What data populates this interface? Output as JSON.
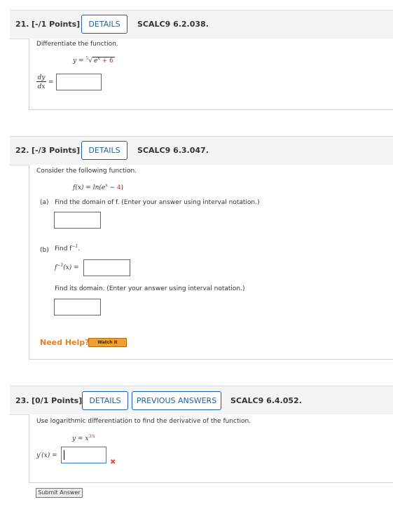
{
  "q21": {
    "number": "21.",
    "points": "[-/1 Points]",
    "details": "DETAILS",
    "code": "SCALC9 6.2.038.",
    "prompt": "Differentiate the function.",
    "func_lhs": "y =",
    "root_index": "5",
    "radicand_base": "e",
    "radicand_exp": "x",
    "radicand_tail": "+ 6",
    "dy": "dy",
    "dx": "dx",
    "eq": "="
  },
  "q22": {
    "number": "22.",
    "points": "[-/3 Points]",
    "details": "DETAILS",
    "code": "SCALC9 6.3.047.",
    "prompt": "Consider the following function.",
    "func": "f(x) = ln(e",
    "func_exp": "x",
    "func_minus": " − ",
    "func_const": "4",
    "func_close": ")",
    "part_a_label": "(a)",
    "part_a_text": "Find the domain of f. (Enter your answer using interval notation.)",
    "part_b_label": "(b)",
    "part_b_text": "Find f",
    "part_b_sup": "−1",
    "part_b_period": ".",
    "finv_label": "f",
    "finv_sup": "−1",
    "finv_tail": "(x) =",
    "domain_text": "Find its domain. (Enter your answer using interval notation.)",
    "need_help": "Need Help?",
    "watch_it": "Watch It"
  },
  "q23": {
    "number": "23.",
    "points": "[0/1 Points]",
    "details": "DETAILS",
    "previous": "PREVIOUS ANSWERS",
    "code": "SCALC9 6.4.052.",
    "prompt": "Use logarithmic differentiation to find the derivative of the function.",
    "func_lhs": "y = x",
    "func_exp": "3/x",
    "answer_label": "y′(x) =",
    "wrong_mark": "✖",
    "submit": "Submit Answer"
  },
  "colors": {
    "accent": "#1f5f9f",
    "red": "#c0392b",
    "need_help": "#e67e22",
    "watch_bg": "#f0a030"
  }
}
